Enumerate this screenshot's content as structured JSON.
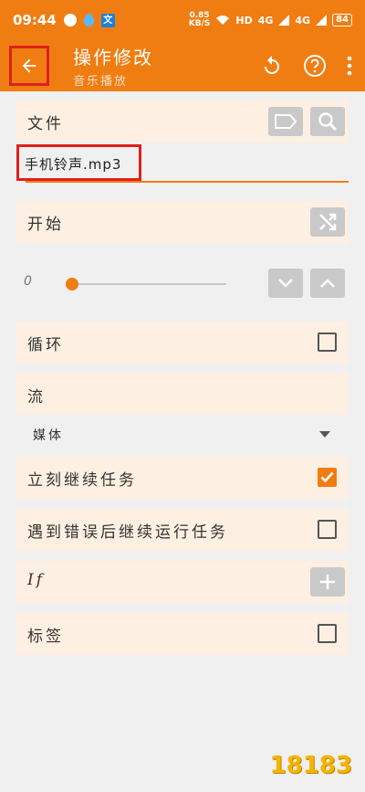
{
  "status_bar": {
    "time": "09:44",
    "app_badge": "文",
    "net_speed": "0.85",
    "net_unit": "KB/S",
    "hd": "HD",
    "signal1": "4G",
    "signal2": "4G",
    "battery": "84"
  },
  "app_bar": {
    "title": "操作修改",
    "subtitle": "音乐播放"
  },
  "file": {
    "label": "文件",
    "value": "手机铃声.mp3"
  },
  "start": {
    "label": "开始"
  },
  "slider": {
    "value": "0",
    "level": 0
  },
  "loop": {
    "label": "循环",
    "checked": false
  },
  "stream": {
    "label": "流",
    "value": "媒体"
  },
  "continue_now": {
    "label": "立刻继续任务",
    "checked": true
  },
  "continue_on_error": {
    "label": "遇到错误后继续运行任务",
    "checked": false
  },
  "if": {
    "label": "If"
  },
  "tag": {
    "label": "标签",
    "checked": false
  },
  "watermark": "18183",
  "colors": {
    "accent": "#f07d12",
    "card": "#fdf0e2",
    "highlight": "#e01f1f"
  }
}
